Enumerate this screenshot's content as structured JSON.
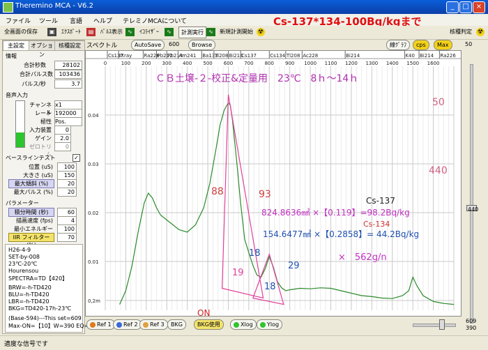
{
  "window": {
    "title": "Theremino MCA - V6.2",
    "min": "_",
    "max": "□",
    "close": "×"
  },
  "menu": [
    "ファイル",
    "ツール",
    "言語",
    "ヘルプ",
    "テレミノMCAについて"
  ],
  "banner": "Cs-137*134-100Bq/kgまで",
  "toolbar": {
    "save_all": "全画面の保存",
    "export": "ｴｸｽﾎﾟｰﾄ",
    "pulse_display": "ﾊﾟﾙｽ表示",
    "equalizer": "ｲｺﾗｲｻﾞｰ",
    "run": "計測実行",
    "new_start": "新規計測開始",
    "isotope_id": "核種判定"
  },
  "left_tabs": [
    "主設定",
    "オプション",
    "核種設定"
  ],
  "info": {
    "title": "情報",
    "total_seconds_label": "合計秒数",
    "total_seconds": "28102",
    "total_pulses_label": "合計パルス数",
    "total_pulses": "103436",
    "pulses_per_sec_label": "パルス/秒",
    "pulses_per_sec": "3.7"
  },
  "audio": {
    "title": "音声入力",
    "channel_label": "チャンネル",
    "channel": "x1",
    "rate_label": "レート",
    "rate": "192000",
    "polarity_label": "極性",
    "polarity": "Pos.",
    "device_label": "入力装置",
    "device": "0",
    "gain_label": "ゲイン",
    "gain": "2.0",
    "zero_label": "ゼロトリム",
    "zero": "0",
    "level_fraction": 0.32
  },
  "baseline": {
    "title": "ベースラインテスト",
    "position_label": "位置 (uS)",
    "position": "100",
    "size_label": "大きさ (uS)",
    "size": "150",
    "max_slope_label": "最大傾斜 (%)",
    "max_slope": "20",
    "max_width_label": "最大パルス (%)",
    "max_width": "20"
  },
  "params": {
    "title": "パラメーター",
    "integration_label": "積分時間 (秒)",
    "integration": "60",
    "draw_speed_label": "描画速度 (fps)",
    "draw_speed": "4",
    "min_energy_label": "最小エネルギー",
    "min_energy": "100",
    "iir_label": "IIR フィルター (%)",
    "iir": "70"
  },
  "notes": [
    "H26-4-9",
    "SET-by-008",
    "23℃-20℃",
    "Hourensou",
    "SPECTRA=TD【420】",
    "",
    "BRW=-h-TD420",
    "BLU=-h-TD420",
    "LBR=-h-TD420",
    "BKG=TD420-17h-23℃",
    "",
    "(Base-594)---This set=609",
    "Max-ON=【10】W=390 EQ=ON"
  ],
  "chart_header": {
    "title": "スペクトル",
    "autosave": "AutoSave",
    "autosave_val": "600",
    "browse": "Browse",
    "line_graph": "線ｸﾞﾗﾌ",
    "cps": "cps",
    "max": "Max",
    "right_val": "50"
  },
  "chart_data": {
    "type": "line",
    "xlim": [
      0,
      1700
    ],
    "ylim": [
      0,
      0.05
    ],
    "x_ticks": [
      0,
      100,
      200,
      300,
      400,
      500,
      600,
      700,
      800,
      900,
      1000,
      1100,
      1200,
      1300,
      1400,
      1500,
      1600
    ],
    "y_ticks": [
      {
        "v": 0.04,
        "label": "0.04"
      },
      {
        "v": 0.03,
        "label": "0.03"
      },
      {
        "v": 0.02,
        "label": "0.02"
      },
      {
        "v": 0.01,
        "label": "0.01"
      },
      {
        "v": 0.002,
        "label": "0,2m"
      }
    ],
    "isotope_labels": [
      {
        "x": 10,
        "text": "Cs137"
      },
      {
        "x": 65,
        "text": "IXray"
      },
      {
        "x": 185,
        "text": "Ra226"
      },
      {
        "x": 250,
        "text": "Pb212"
      },
      {
        "x": 300,
        "text": "Pb214"
      },
      {
        "x": 355,
        "text": "Am241"
      },
      {
        "x": 470,
        "text": "Ba133"
      },
      {
        "x": 530,
        "text": "Tl208"
      },
      {
        "x": 600,
        "text": "Bi214"
      },
      {
        "x": 660,
        "text": "Cs137"
      },
      {
        "x": 800,
        "text": "Cs134"
      },
      {
        "x": 880,
        "text": "Tl208"
      },
      {
        "x": 960,
        "text": "Ac228"
      },
      {
        "x": 1170,
        "text": "Bi214"
      },
      {
        "x": 1460,
        "text": "K40"
      },
      {
        "x": 1530,
        "text": "Bi214"
      },
      {
        "x": 1630,
        "text": "Ra226"
      }
    ],
    "series": [
      {
        "color": "#2a8a2a",
        "x": [
          70,
          100,
          130,
          160,
          190,
          210,
          230,
          250,
          270,
          300,
          330,
          360,
          400,
          440,
          480,
          510,
          540,
          560,
          580,
          600,
          610,
          620,
          640,
          660,
          680,
          700,
          720,
          740,
          760,
          780,
          800,
          820,
          840,
          860,
          880,
          900,
          950,
          1000,
          1050,
          1100,
          1150,
          1200,
          1250,
          1300,
          1350,
          1400,
          1450,
          1480,
          1500,
          1520,
          1550,
          1600,
          1650,
          1700
        ],
        "y": [
          0.0012,
          0.004,
          0.009,
          0.016,
          0.022,
          0.024,
          0.023,
          0.021,
          0.0195,
          0.0185,
          0.0175,
          0.0165,
          0.016,
          0.0175,
          0.021,
          0.026,
          0.033,
          0.038,
          0.041,
          0.0425,
          0.042,
          0.039,
          0.031,
          0.022,
          0.0145,
          0.0118,
          0.0092,
          0.0072,
          0.0068,
          0.0085,
          0.011,
          0.0088,
          0.0058,
          0.0046,
          0.004,
          0.0042,
          0.0045,
          0.0044,
          0.0046,
          0.0045,
          0.004,
          0.0035,
          0.003,
          0.0028,
          0.0025,
          0.0024,
          0.003,
          0.004,
          0.0068,
          0.005,
          0.003,
          0.0018,
          0.0014,
          0.0012
        ]
      }
    ],
    "overlays": {
      "tri1": [
        [
          570,
          0.0045
        ],
        [
          600,
          0.0442
        ],
        [
          770,
          0.0025
        ]
      ],
      "tri2": [
        [
          720,
          0.0025
        ],
        [
          800,
          0.0115
        ],
        [
          870,
          0.0012
        ]
      ]
    },
    "annotations": {
      "title": "ＣＢ土壌-２-校正&定量用　23℃　8ｈ～14ｈ",
      "n50": "50",
      "n440": "440",
      "n88": "88",
      "n93": "93",
      "cs137": "Cs-137",
      "eq1": "824.8636㎣ ×【0.119】=98.2Bq/kg",
      "cs134": "Cs-134",
      "eq2": "154.6477㎣ ×【0.2858】= 44.2Bq/kg",
      "n18a": "18",
      "n29": "29",
      "n19": "19",
      "n18b": "18",
      "mass": "×　562g/n",
      "on": "ON"
    }
  },
  "right_scale": {
    "v440": "440",
    "v609": "609",
    "v390": "390"
  },
  "bottom": {
    "ref1": "Ref 1",
    "ref2": "Ref 2",
    "ref3": "Ref 3",
    "bkg": "BKG",
    "bkg_use": "BKG使用",
    "xlog": "Xlog",
    "ylog": "Ylog"
  },
  "status": "適度な信号です"
}
